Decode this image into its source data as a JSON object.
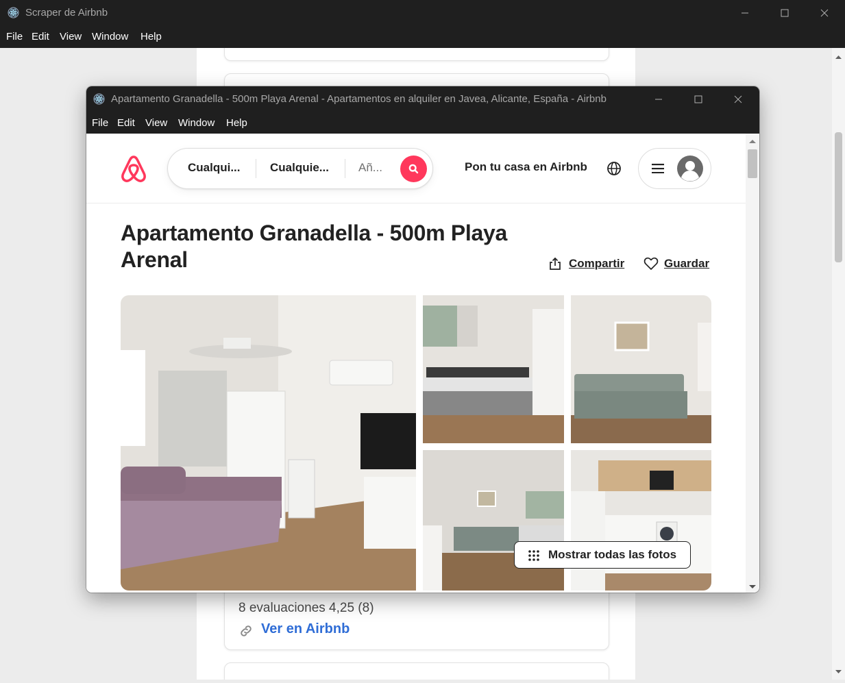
{
  "outer_window": {
    "title": "Scraper de Airbnb",
    "menu": [
      "File",
      "Edit",
      "View",
      "Window",
      "Help"
    ],
    "card": {
      "reviews_text": "8 evaluaciones 4,25 (8)",
      "link_text": "Ver en Airbnb"
    }
  },
  "inner_window": {
    "title": "Apartamento Granadella - 500m Playa Arenal - Apartamentos en alquiler en Javea, Alicante, España - Airbnb",
    "menu": [
      "File",
      "Edit",
      "View",
      "Window",
      "Help"
    ]
  },
  "airbnb": {
    "search": {
      "location": "Cualqui...",
      "dates": "Cualquie...",
      "guests": "Añ..."
    },
    "host_link": "Pon tu casa en Airbnb",
    "listing": {
      "title": "Apartamento Granadella - 500m Playa Arenal",
      "share_label": "Compartir",
      "save_label": "Guardar",
      "show_all_photos": "Mostrar todas las fotos"
    }
  },
  "colors": {
    "brand": "#ff385c",
    "link_blue": "#2f6dd6",
    "titlebar": "#1f1f1f"
  }
}
